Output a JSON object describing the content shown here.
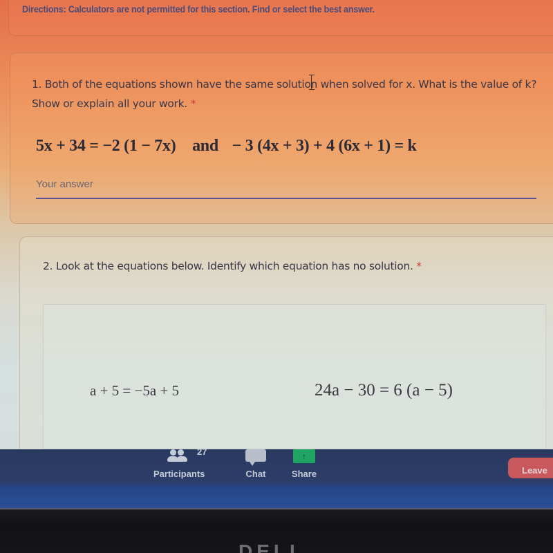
{
  "form": {
    "directions": "Directions: Calculators are not permitted for this section. Find or select the best answer.",
    "questions": [
      {
        "number": "1.",
        "text": "Both of the equations shown have the same solution when solved for x. What is the value of k? Show or explain all your work.",
        "required_mark": "*",
        "equation_left": "5x + 34 = −2 (1 − 7x)",
        "equation_join": "and",
        "equation_right": "− 3 (4x + 3) + 4 (6x + 1) = k",
        "answer": {
          "value": "",
          "placeholder": "Your answer"
        }
      },
      {
        "number": "2.",
        "text": "Look at the equations below. Identify which equation has no solution.",
        "required_mark": "*",
        "equations": [
          "a + 5 = −5a + 5",
          "24a − 30 = 6 (a − 5)"
        ]
      }
    ]
  },
  "meeting_toolbar": {
    "participants": {
      "label": "Participants",
      "count": "27",
      "icon": "participants-icon"
    },
    "chat": {
      "label": "Chat",
      "icon": "chat-icon"
    },
    "share": {
      "label": "Share",
      "icon": "share-arrow-icon",
      "glyph": "↑"
    },
    "leave": {
      "label": "Leave"
    },
    "colors": {
      "toolbar_bg": "#2c3d68",
      "share_green": "#1fa463",
      "leave_red": "#c9585e"
    }
  },
  "colors": {
    "header_orange": "#e46f48",
    "required_red": "#d03a3a",
    "input_underline": "#5b4f8f",
    "text_dark": "#3a3648"
  }
}
